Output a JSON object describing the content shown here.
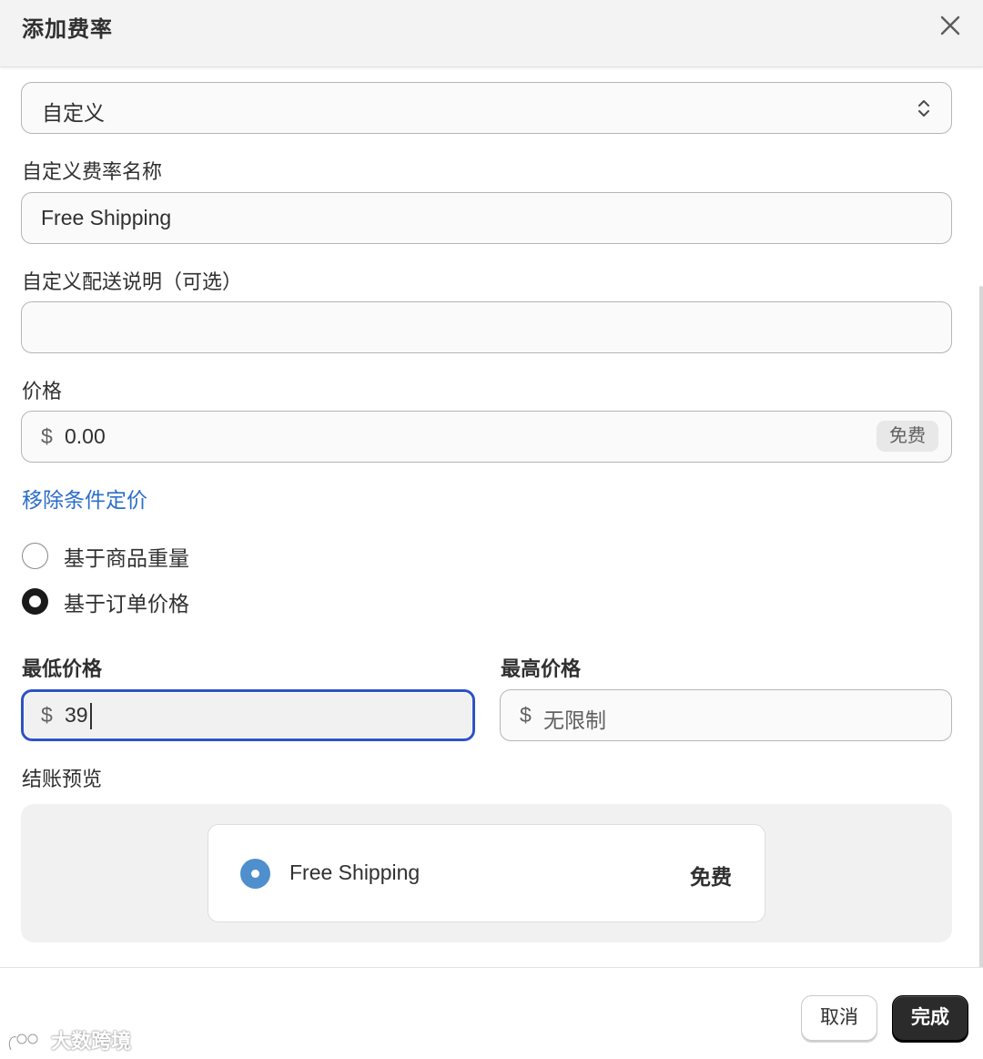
{
  "header": {
    "title": "添加费率"
  },
  "rate_type": {
    "selected": "自定义"
  },
  "rate_name": {
    "label": "自定义费率名称",
    "value": "Free Shipping"
  },
  "delivery_description": {
    "label": "自定义配送说明（可选）",
    "value": ""
  },
  "price": {
    "label": "价格",
    "currency": "$",
    "value": "0.00",
    "badge": "免费"
  },
  "conditions": {
    "remove_link": "移除条件定价",
    "options": [
      {
        "label": "基于商品重量",
        "selected": false
      },
      {
        "label": "基于订单价格",
        "selected": true
      }
    ]
  },
  "min_price": {
    "label": "最低价格",
    "currency": "$",
    "value": "39"
  },
  "max_price": {
    "label": "最高价格",
    "currency": "$",
    "placeholder": "无限制"
  },
  "preview": {
    "label": "结账预览",
    "rate_name": "Free Shipping",
    "rate_price": "免费"
  },
  "footer": {
    "cancel_label": "取消",
    "done_label": "完成"
  },
  "watermark": {
    "text": "大数跨境"
  },
  "colors": {
    "accent_link": "#2c6ecb",
    "focus_border": "#2d52c7",
    "primary_button": "#2b2b2b",
    "preview_radio": "#4f8fce"
  }
}
